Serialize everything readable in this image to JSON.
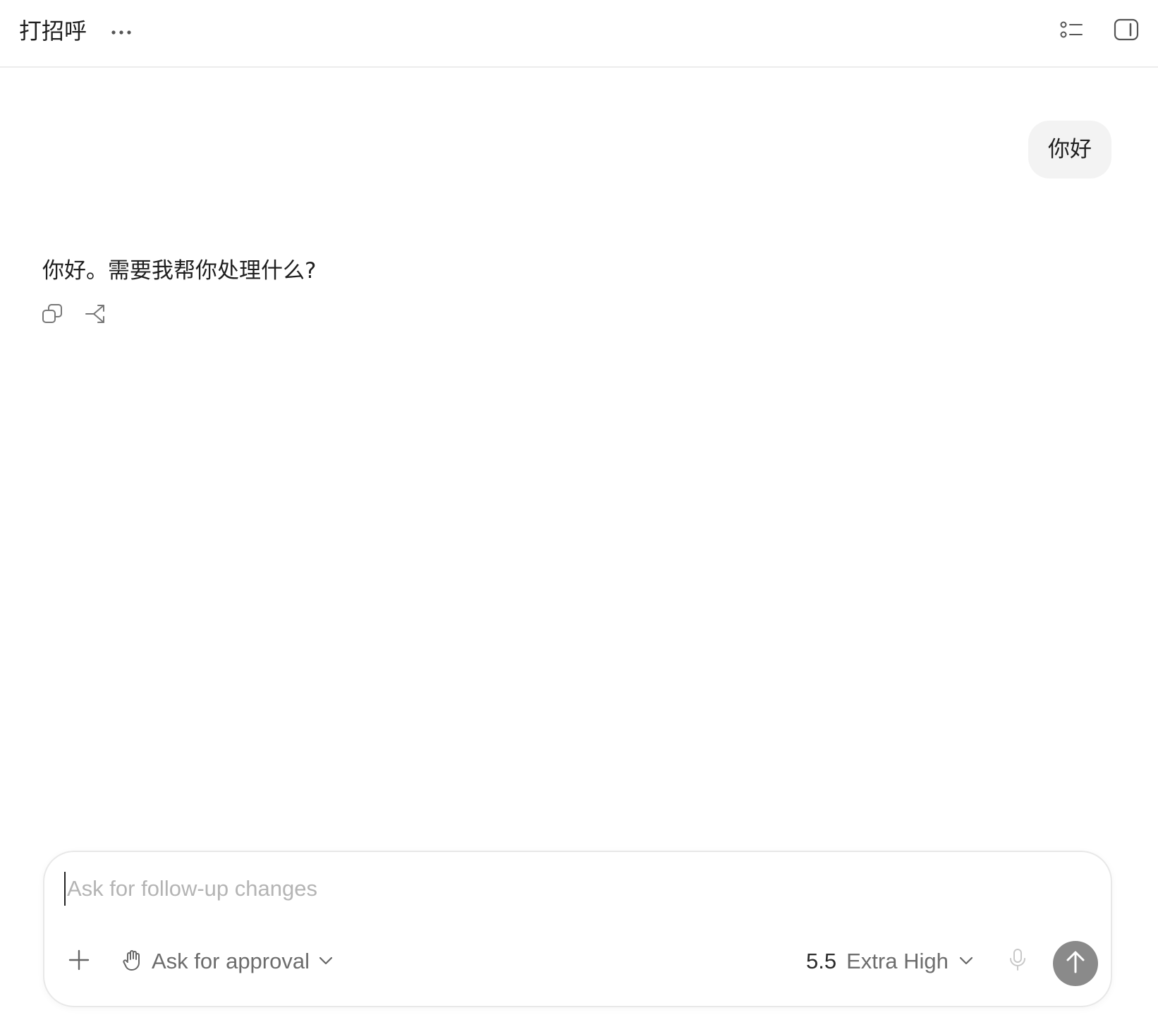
{
  "header": {
    "title": "打招呼",
    "more_icon": "ellipsis-icon",
    "right_icons": [
      "list-icon",
      "panel-toggle-icon"
    ]
  },
  "messages": {
    "user": "你好",
    "assistant": "你好。需要我帮你处理什么?",
    "assistant_actions": [
      "copy-icon",
      "branch-icon"
    ]
  },
  "composer": {
    "placeholder": "Ask for follow-up changes",
    "value": "",
    "approval_label": "Ask for approval",
    "model_version": "5.5",
    "model_effort": "Extra High",
    "icons": [
      "plus-icon",
      "hand-icon",
      "chevron-down-icon",
      "mic-icon",
      "arrow-up-icon"
    ]
  },
  "colors": {
    "background": "#ffffff",
    "user_bubble": "#f3f3f3",
    "send_button": "#8a8a8a",
    "placeholder": "#b4b4b4",
    "muted_text": "#6d6d6d"
  }
}
